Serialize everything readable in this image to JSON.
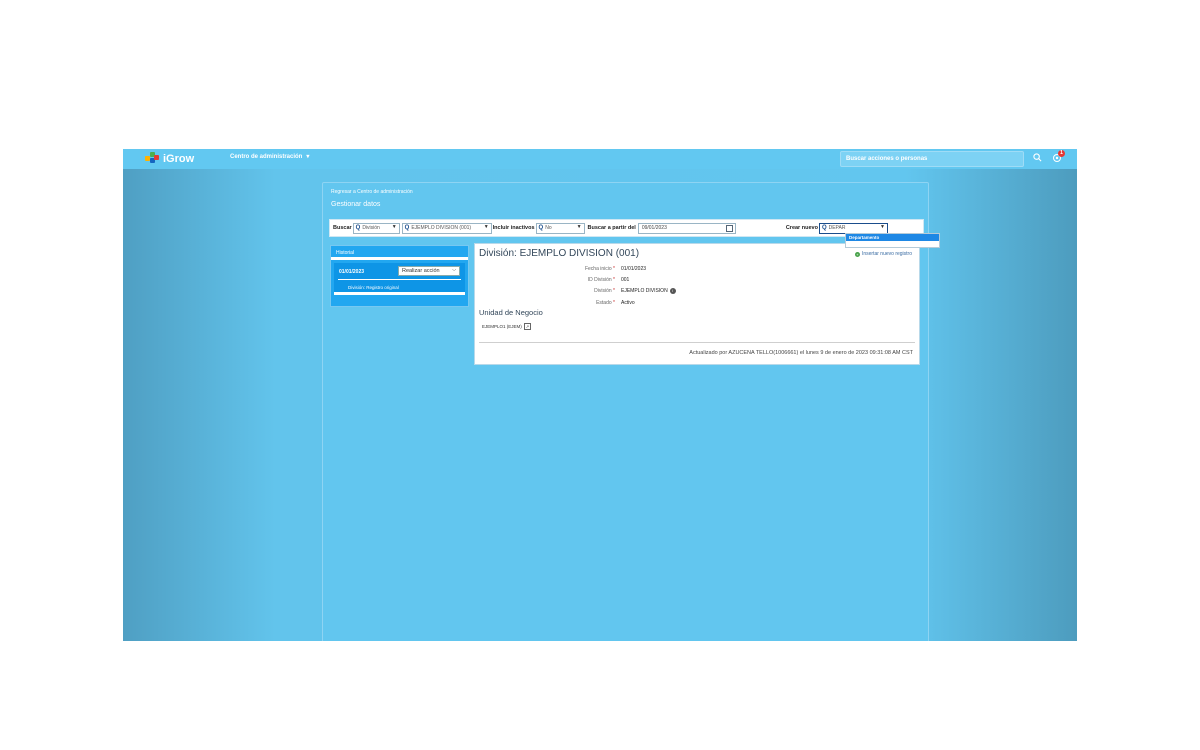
{
  "header": {
    "logo_text": "iGrow",
    "menu_label": "Centro de administración",
    "search_placeholder": "Buscar acciones o personas",
    "notification_count": "1"
  },
  "page": {
    "back_link": "Regresar a Centro de administración",
    "title": "Gestionar datos"
  },
  "toolbar": {
    "buscar_label": "Buscar",
    "buscar_type": "División",
    "buscar_value": "EJEMPLO DIVISION (001)",
    "incluir_label": "Incluir inactivos",
    "incluir_value": "No",
    "desde_label": "Buscar a partir del",
    "desde_value": "09/01/2023",
    "crear_label": "Crear nuevo",
    "crear_value": "DEPAR"
  },
  "dropdown": {
    "option": "Departamento"
  },
  "history": {
    "header": "Historial",
    "date": "01/01/2023",
    "action_button": "Realizar acción",
    "subtitle": "División: Registro original"
  },
  "detail": {
    "title": "División: EJEMPLO DIVISION (001)",
    "insert_link": "Insertar nuevo registro",
    "fields": [
      {
        "label": "Fecha inicio",
        "value": "01/01/2023"
      },
      {
        "label": "ID División",
        "value": "001"
      },
      {
        "label": "División",
        "value": "EJEMPLO DIVISION"
      },
      {
        "label": "Estado",
        "value": "Activo"
      }
    ],
    "section_title": "Unidad de Negocio",
    "business_unit": "EJEMPLO1 (EJEM)",
    "footer": "Actualizado por AZUCENA TELLO(1006661) el lunes 9 de enero de 2023 09:31:08 AM CST"
  },
  "colors": {
    "shell": "#62c8f1",
    "accent": "#1e88e5",
    "history": "#22a7f0"
  }
}
